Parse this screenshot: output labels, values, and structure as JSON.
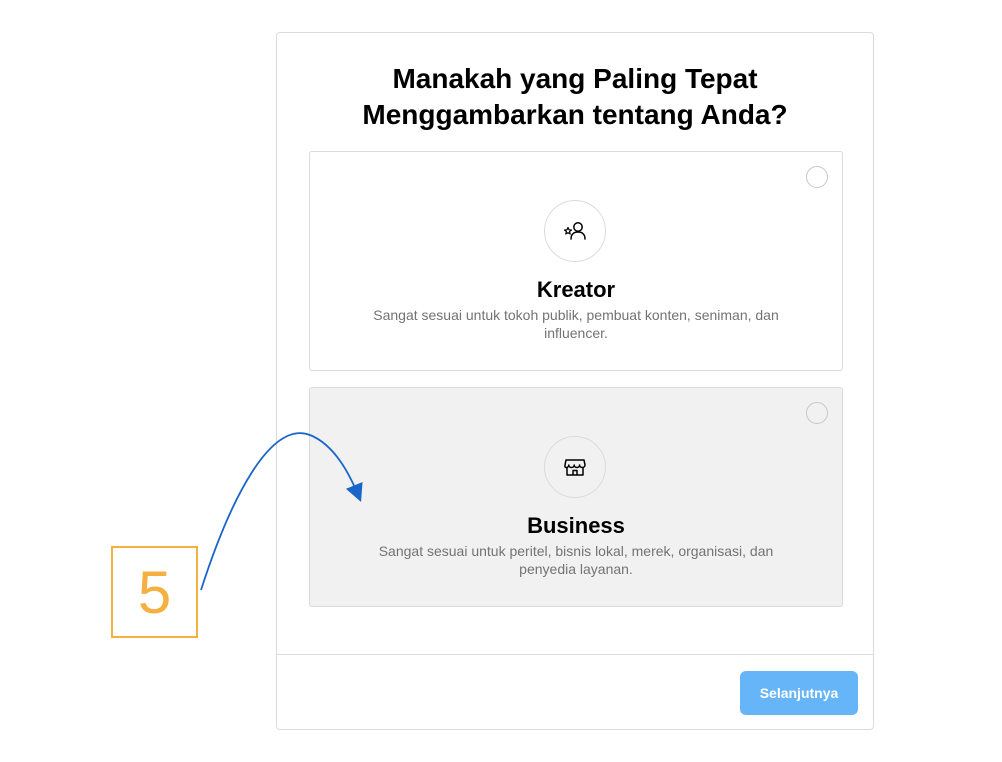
{
  "dialog": {
    "title_line1": "Manakah yang Paling Tepat",
    "title_line2": "Menggambarkan tentang Anda?",
    "options": [
      {
        "label": "Kreator",
        "description": "Sangat sesuai untuk tokoh publik, pembuat konten, seniman, dan influencer.",
        "icon": "star-person-icon",
        "selected": false
      },
      {
        "label": "Business",
        "description": "Sangat sesuai untuk peritel, bisnis lokal, merek, organisasi, dan penyedia layanan.",
        "icon": "storefront-icon",
        "selected": false
      }
    ],
    "next_label": "Selanjutnya"
  },
  "annotation": {
    "step_number": "5",
    "step_color": "#f5b041",
    "arrow_color": "#1a66c8"
  },
  "colors": {
    "primary_button": "#67b5f9",
    "highlight_background": "#f1f1f1",
    "border": "#dbdbdb"
  }
}
